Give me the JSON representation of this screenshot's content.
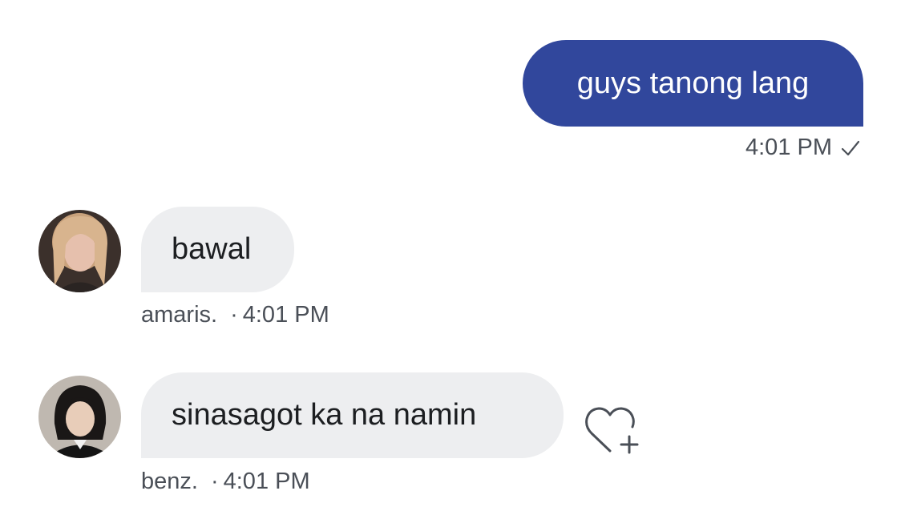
{
  "messages": [
    {
      "direction": "outgoing",
      "text": "guys tanong lang",
      "time": "4:01 PM",
      "status_icon": "check-icon"
    },
    {
      "direction": "incoming",
      "sender": "amaris.",
      "text": "bawal",
      "time": "4:01 PM",
      "avatar_icon": "avatar"
    },
    {
      "direction": "incoming",
      "sender": "benz.",
      "text": "sinasagot ka na namin",
      "time": "4:01 PM",
      "avatar_icon": "avatar",
      "reaction_icon": "heart-add-icon"
    }
  ],
  "separator": "·",
  "colors": {
    "outgoing_bubble": "#31479c",
    "incoming_bubble": "#edeef0",
    "meta_text": "#4a4f57",
    "background": "#ffffff"
  }
}
